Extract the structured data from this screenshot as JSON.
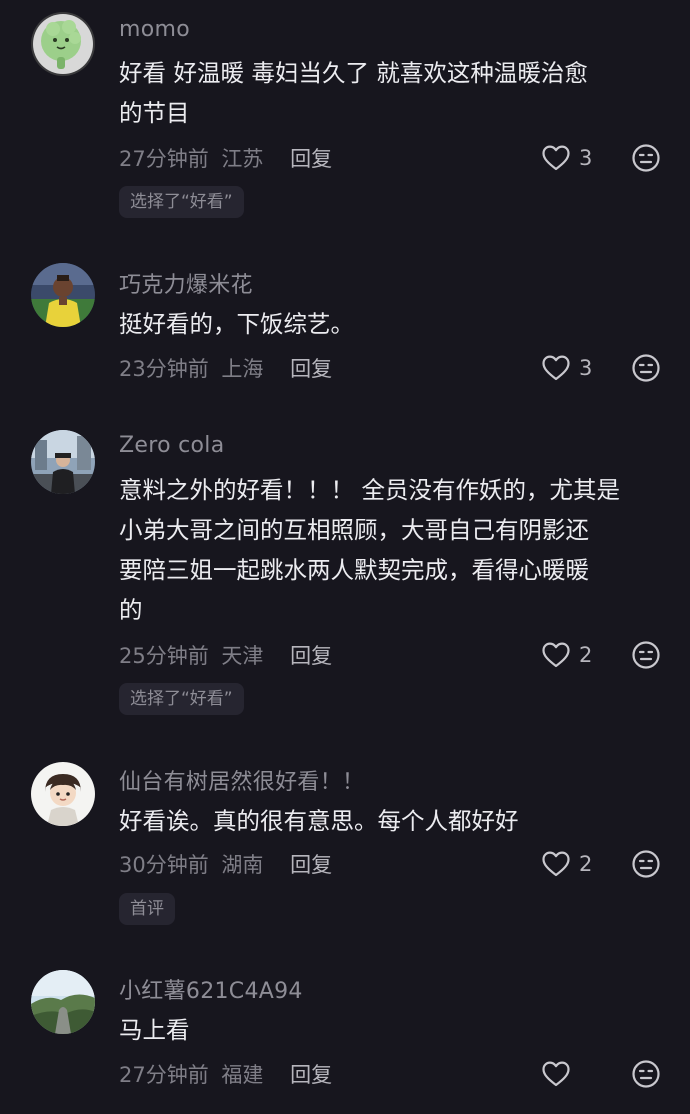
{
  "comments": [
    {
      "username": "momo",
      "text": "好看 好温暖  毒妇当久了 就喜欢这种温暖治愈\n的节目",
      "time": "27分钟前",
      "location": "江苏",
      "reply_label": "回复",
      "likes": "3",
      "tag": "选择了“好看”",
      "avatar_icon": "leaf-character-icon"
    },
    {
      "username": "巧克力爆米花",
      "text": "挺好看的，下饭综艺。",
      "time": "23分钟前",
      "location": "上海",
      "reply_label": "回复",
      "likes": "3",
      "avatar_icon": "soccer-player-icon"
    },
    {
      "username": "Zero cola",
      "text": "意料之外的好看！！！ 全员没有作妖的，尤其是\n小弟大哥之间的互相照顾，大哥自己有阴影还\n要陪三姐一起跳水两人默契完成，看得心暖暖\n的",
      "time": "25分钟前",
      "location": "天津",
      "reply_label": "回复",
      "likes": "2",
      "tag": "选择了“好看”",
      "avatar_icon": "street-photo-icon"
    },
    {
      "username": "仙台有树居然很好看！！",
      "text": "好看诶。真的很有意思。每个人都好好",
      "time": "30分钟前",
      "location": "湖南",
      "reply_label": "回复",
      "likes": "2",
      "tag": "首评",
      "avatar_icon": "cartoon-boy-icon"
    },
    {
      "username": "小红薯621C4A94",
      "text": "马上看",
      "time": "27分钟前",
      "location": "福建",
      "reply_label": "回复",
      "likes": "",
      "avatar_icon": "landscape-icon"
    }
  ],
  "colors": {
    "background": "#17161e",
    "username": "#8e8d96",
    "text": "#ececf0",
    "meta": "#7f7e87",
    "tag_bg": "#262530"
  }
}
